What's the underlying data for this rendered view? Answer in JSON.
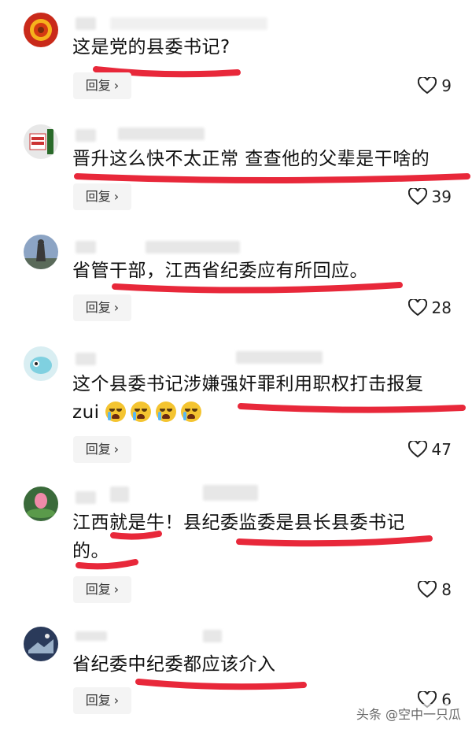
{
  "reply_label": "回复",
  "comments": [
    {
      "text": "这是党的县委书记?",
      "likes": "9"
    },
    {
      "text": "晋升这么快不太正常 查查他的父辈是干啥的",
      "likes": "39"
    },
    {
      "text": "省管干部，江西省纪委应有所回应。",
      "likes": "28"
    },
    {
      "text_line1": "这个县委书记涉嫌强奸罪利用职权打击报复",
      "text_line2": "zui",
      "likes": "47"
    },
    {
      "text_line1": "江西就是牛！县纪委监委是县长县委书记",
      "text_line2": "的。",
      "likes": "8"
    },
    {
      "text": "省纪委中纪委都应该介入",
      "likes": "6"
    }
  ],
  "watermark": "头条 @空中一只瓜",
  "colors": {
    "underline": "#e8283a",
    "reply_bg": "#f4f4f4"
  },
  "icons": {
    "like": "heart-outline-icon",
    "reply_chevron": "chevron-right-icon"
  }
}
